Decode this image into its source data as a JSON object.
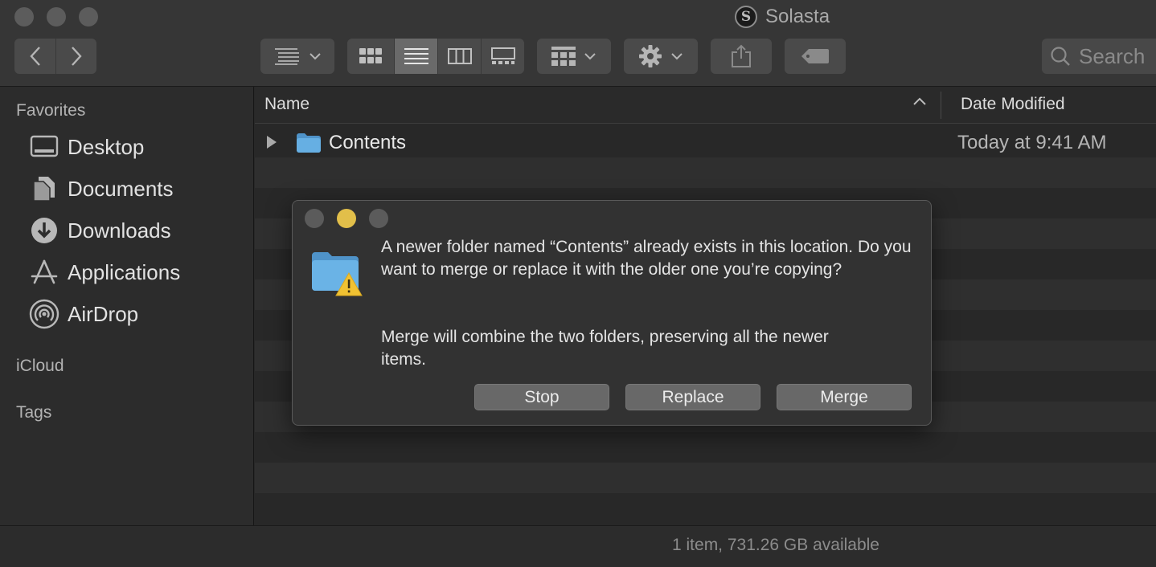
{
  "window": {
    "title": "Solasta",
    "app_icon_letter": "S"
  },
  "toolbar": {
    "search_placeholder": "Search"
  },
  "sidebar": {
    "favorites_heading": "Favorites",
    "items": [
      {
        "label": "Desktop",
        "icon": "desktop-icon"
      },
      {
        "label": "Documents",
        "icon": "documents-icon"
      },
      {
        "label": "Downloads",
        "icon": "downloads-icon"
      },
      {
        "label": "Applications",
        "icon": "applications-icon"
      },
      {
        "label": "AirDrop",
        "icon": "airdrop-icon"
      }
    ],
    "icloud_heading": "iCloud",
    "tags_heading": "Tags"
  },
  "list": {
    "columns": {
      "name": "Name",
      "date": "Date Modified"
    },
    "rows": [
      {
        "name": "Contents",
        "date": "Today at 9:41 AM"
      }
    ]
  },
  "status": {
    "text": "1 item, 731.26 GB available"
  },
  "dialog": {
    "message": "A newer folder named “Contents” already exists in this location. Do you want to merge or replace it with the older one you’re copying?",
    "detail": "Merge will combine the two folders, preserving all the newer items.",
    "buttons": {
      "stop": "Stop",
      "replace": "Replace",
      "merge": "Merge"
    }
  },
  "colors": {
    "folder": "#5fa8dc",
    "warning": "#f1c232",
    "minimize": "#e2bf4a"
  }
}
